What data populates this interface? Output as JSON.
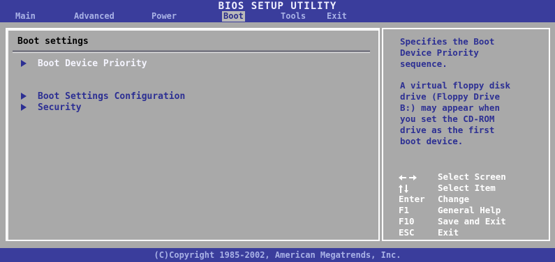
{
  "header": {
    "title": "BIOS SETUP UTILITY",
    "tabs": [
      {
        "label": "Main"
      },
      {
        "label": "Advanced"
      },
      {
        "label": "Power"
      },
      {
        "label": "Boot"
      },
      {
        "label": "Tools"
      },
      {
        "label": "Exit"
      }
    ],
    "active_tab": "Boot"
  },
  "main": {
    "section_title": "Boot settings",
    "items": [
      {
        "label": "Boot Device Priority",
        "selected": true
      },
      {
        "label": "Boot Settings Configuration"
      },
      {
        "label": "Security"
      }
    ]
  },
  "help": {
    "description": "Specifies the Boot\nDevice Priority\nsequence.",
    "note": "A virtual floppy disk\ndrive (Floppy Drive\nB:) may appear when\nyou set the CD-ROM\ndrive as the first\nboot device.",
    "keys": [
      {
        "icon": "left-right-arrows-icon",
        "key": "",
        "action": "Select Screen"
      },
      {
        "icon": "up-down-arrows-icon",
        "key": "",
        "action": "Select Item"
      },
      {
        "key": "Enter",
        "action": "Change"
      },
      {
        "key": "F1",
        "action": "General Help"
      },
      {
        "key": "F10",
        "action": "Save and Exit"
      },
      {
        "key": "ESC",
        "action": "Exit"
      }
    ]
  },
  "footer": {
    "copyright": "(C)Copyright 1985-2002, American Megatrends, Inc."
  },
  "colors": {
    "bar_blue": "#3a3d9c",
    "panel_gray": "#a9a9a9",
    "text_blue": "#2c2f93",
    "highlight_white": "#ffffff"
  }
}
